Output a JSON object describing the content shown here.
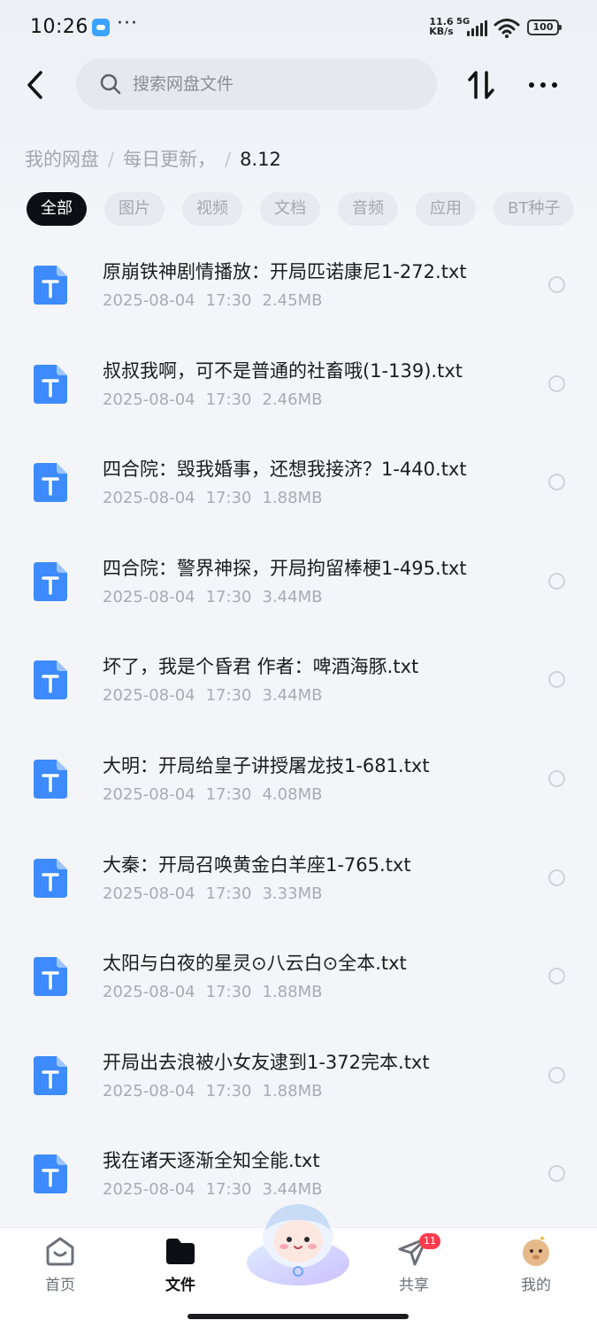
{
  "status_bar": {
    "time": "10:26",
    "dots": "···",
    "net_speed_value": "11.6",
    "net_speed_unit": "KB/s",
    "network": "5G",
    "battery": "100"
  },
  "header": {
    "search_placeholder": "搜索网盘文件",
    "icons": {
      "back": "chevron-left-icon",
      "search": "search-icon",
      "sort": "sort-icon",
      "more": "more-icon"
    }
  },
  "breadcrumb": {
    "items": [
      "我的网盘",
      "每日更新，"
    ],
    "separator": "/",
    "current": "8.12"
  },
  "filters": [
    {
      "label": "全部",
      "active": true
    },
    {
      "label": "图片",
      "active": false
    },
    {
      "label": "视频",
      "active": false
    },
    {
      "label": "文档",
      "active": false
    },
    {
      "label": "音频",
      "active": false
    },
    {
      "label": "应用",
      "active": false
    },
    {
      "label": "BT种子",
      "active": false
    }
  ],
  "files": [
    {
      "name": "原崩铁神剧情播放：开局匹诺康尼1-272.txt",
      "date": "2025-08-04",
      "time": "17:30",
      "size": "2.45MB"
    },
    {
      "name": "叔叔我啊，可不是普通的社畜哦(1-139).txt",
      "date": "2025-08-04",
      "time": "17:30",
      "size": "2.46MB"
    },
    {
      "name": "四合院：毁我婚事，还想我接济？1-440.txt",
      "date": "2025-08-04",
      "time": "17:30",
      "size": "1.88MB"
    },
    {
      "name": "四合院：警界神探，开局拘留棒梗1-495.txt",
      "date": "2025-08-04",
      "time": "17:30",
      "size": "3.44MB"
    },
    {
      "name": "坏了，我是个昏君 作者：啤酒海豚.txt",
      "date": "2025-08-04",
      "time": "17:30",
      "size": "3.44MB"
    },
    {
      "name": "大明：开局给皇子讲授屠龙技1-681.txt",
      "date": "2025-08-04",
      "time": "17:30",
      "size": "4.08MB"
    },
    {
      "name": "大秦：开局召唤黄金白羊座1-765.txt",
      "date": "2025-08-04",
      "time": "17:30",
      "size": "3.33MB"
    },
    {
      "name": "太阳与白夜的星灵⊙八云白⊙全本.txt",
      "date": "2025-08-04",
      "time": "17:30",
      "size": "1.88MB"
    },
    {
      "name": "开局出去浪被小女友逮到1-372完本.txt",
      "date": "2025-08-04",
      "time": "17:30",
      "size": "1.88MB"
    },
    {
      "name": "我在诸天逐渐全知全能.txt",
      "date": "2025-08-04",
      "time": "17:30",
      "size": "3.44MB"
    }
  ],
  "file_icon": {
    "glyph": "T",
    "color": "#3d8bfd"
  },
  "bottom_nav": {
    "home": "首页",
    "files": "文件",
    "share": "共享",
    "share_badge": "11",
    "mine": "我的"
  },
  "colors": {
    "accent": "#3d8bfd",
    "badge": "#ff3b4e",
    "active_chip": "#0e0f14"
  }
}
